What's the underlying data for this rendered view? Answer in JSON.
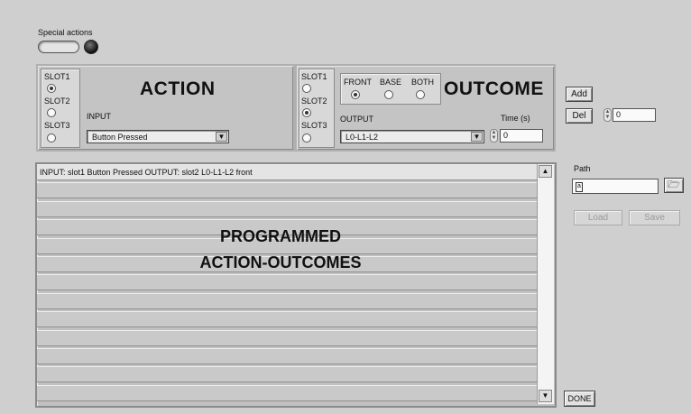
{
  "special_actions": {
    "label": "Special actions"
  },
  "action": {
    "title": "ACTION",
    "slots": [
      "SLOT1",
      "SLOT2",
      "SLOT3"
    ],
    "selected_slot": 1,
    "input_label": "INPUT",
    "input_value": "Button Pressed"
  },
  "outcome": {
    "title": "OUTCOME",
    "slots": [
      "SLOT1",
      "SLOT2",
      "SLOT3"
    ],
    "selected_slot": 2,
    "target_options": [
      "FRONT",
      "BASE",
      "BOTH"
    ],
    "selected_target": "FRONT",
    "output_label": "OUTPUT",
    "output_value": "L0-L1-L2",
    "time_label": "Time (s)",
    "time_value": "0"
  },
  "controls": {
    "add_label": "Add",
    "del_label": "Del",
    "index_value": "0",
    "path_label": "Path",
    "path_value": "",
    "load_label": "Load",
    "save_label": "Save",
    "done_label": "DONE"
  },
  "list": {
    "rows": [
      "INPUT: slot1 Button Pressed  OUTPUT: slot2 L0-L1-L2 front",
      "",
      "",
      "",
      "",
      "",
      "",
      "",
      "",
      "",
      "",
      "",
      ""
    ],
    "overlay_line1": "PROGRAMMED",
    "overlay_line2": "ACTION-OUTCOMES"
  }
}
